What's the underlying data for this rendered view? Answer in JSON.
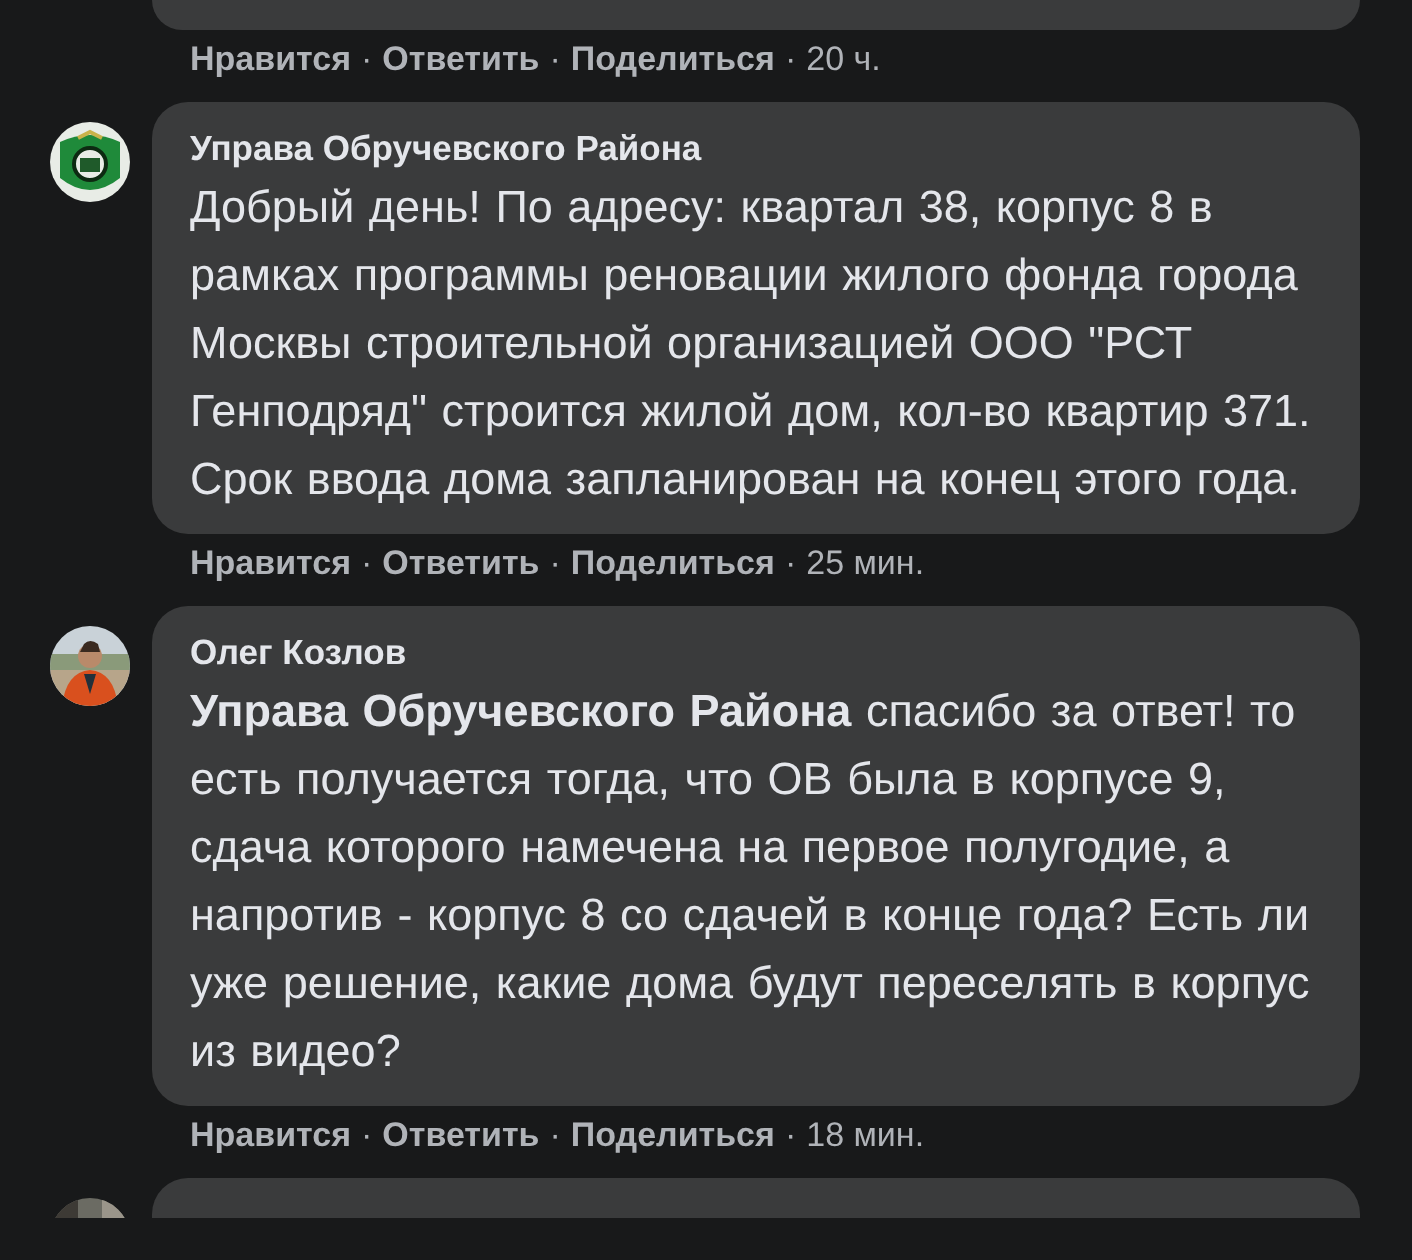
{
  "previous_comment": {
    "actions": [
      "Нравится",
      "Ответить",
      "Поделиться"
    ],
    "separator": "·",
    "time": "20 ч."
  },
  "comments": [
    {
      "author": "Управа Обручевского Района",
      "avatar": {
        "kind": "emblem"
      },
      "text": "Добрый день! По адресу: квартал 38, корпус 8 в рамках программы реновации жилого фонда города Москвы строительной организацией ООО \"РСТ Генподряд\" строится жилой дом, кол-во квартир 371. Срок ввода дома запланирован на конец этого года.",
      "actions": [
        "Нравится",
        "Ответить",
        "Поделиться"
      ],
      "separator": "·",
      "time": "25 мин."
    },
    {
      "author": "Олег Козлов",
      "text": "**Управа Обручевского Района** спасибо за ответ! то есть получается тогда, что ОВ была в корпусе 9, сдача которого намечена на первое полугодие, а напротив - корпус 8 со сдачей в конце года? Есть ли уже решение, какие дома будут переселять в корпус из видео?",
      "actions": [
        "Нравится",
        "Ответить",
        "Поделиться"
      ],
      "separator": "·",
      "time": "18 мин."
    }
  ]
}
